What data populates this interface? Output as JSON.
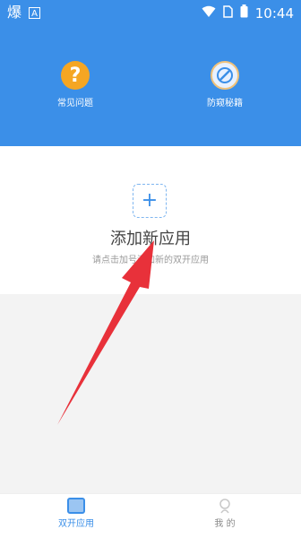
{
  "status_bar": {
    "left_glyph_1": "爆",
    "left_glyph_2": "A",
    "time": "10:44"
  },
  "header": {
    "items": [
      {
        "label": "常见问题",
        "icon": "question-icon"
      },
      {
        "label": "防窥秘籍",
        "icon": "shield-icon"
      }
    ]
  },
  "main": {
    "add_symbol": "+",
    "title": "添加新应用",
    "subtitle": "请点击加号添加新的双开应用"
  },
  "bottom_nav": {
    "items": [
      {
        "label": "双开应用",
        "active": true
      },
      {
        "label": "我 的",
        "active": false
      }
    ]
  },
  "colors": {
    "primary": "#3b8fe8",
    "arrow": "#e8313a"
  }
}
